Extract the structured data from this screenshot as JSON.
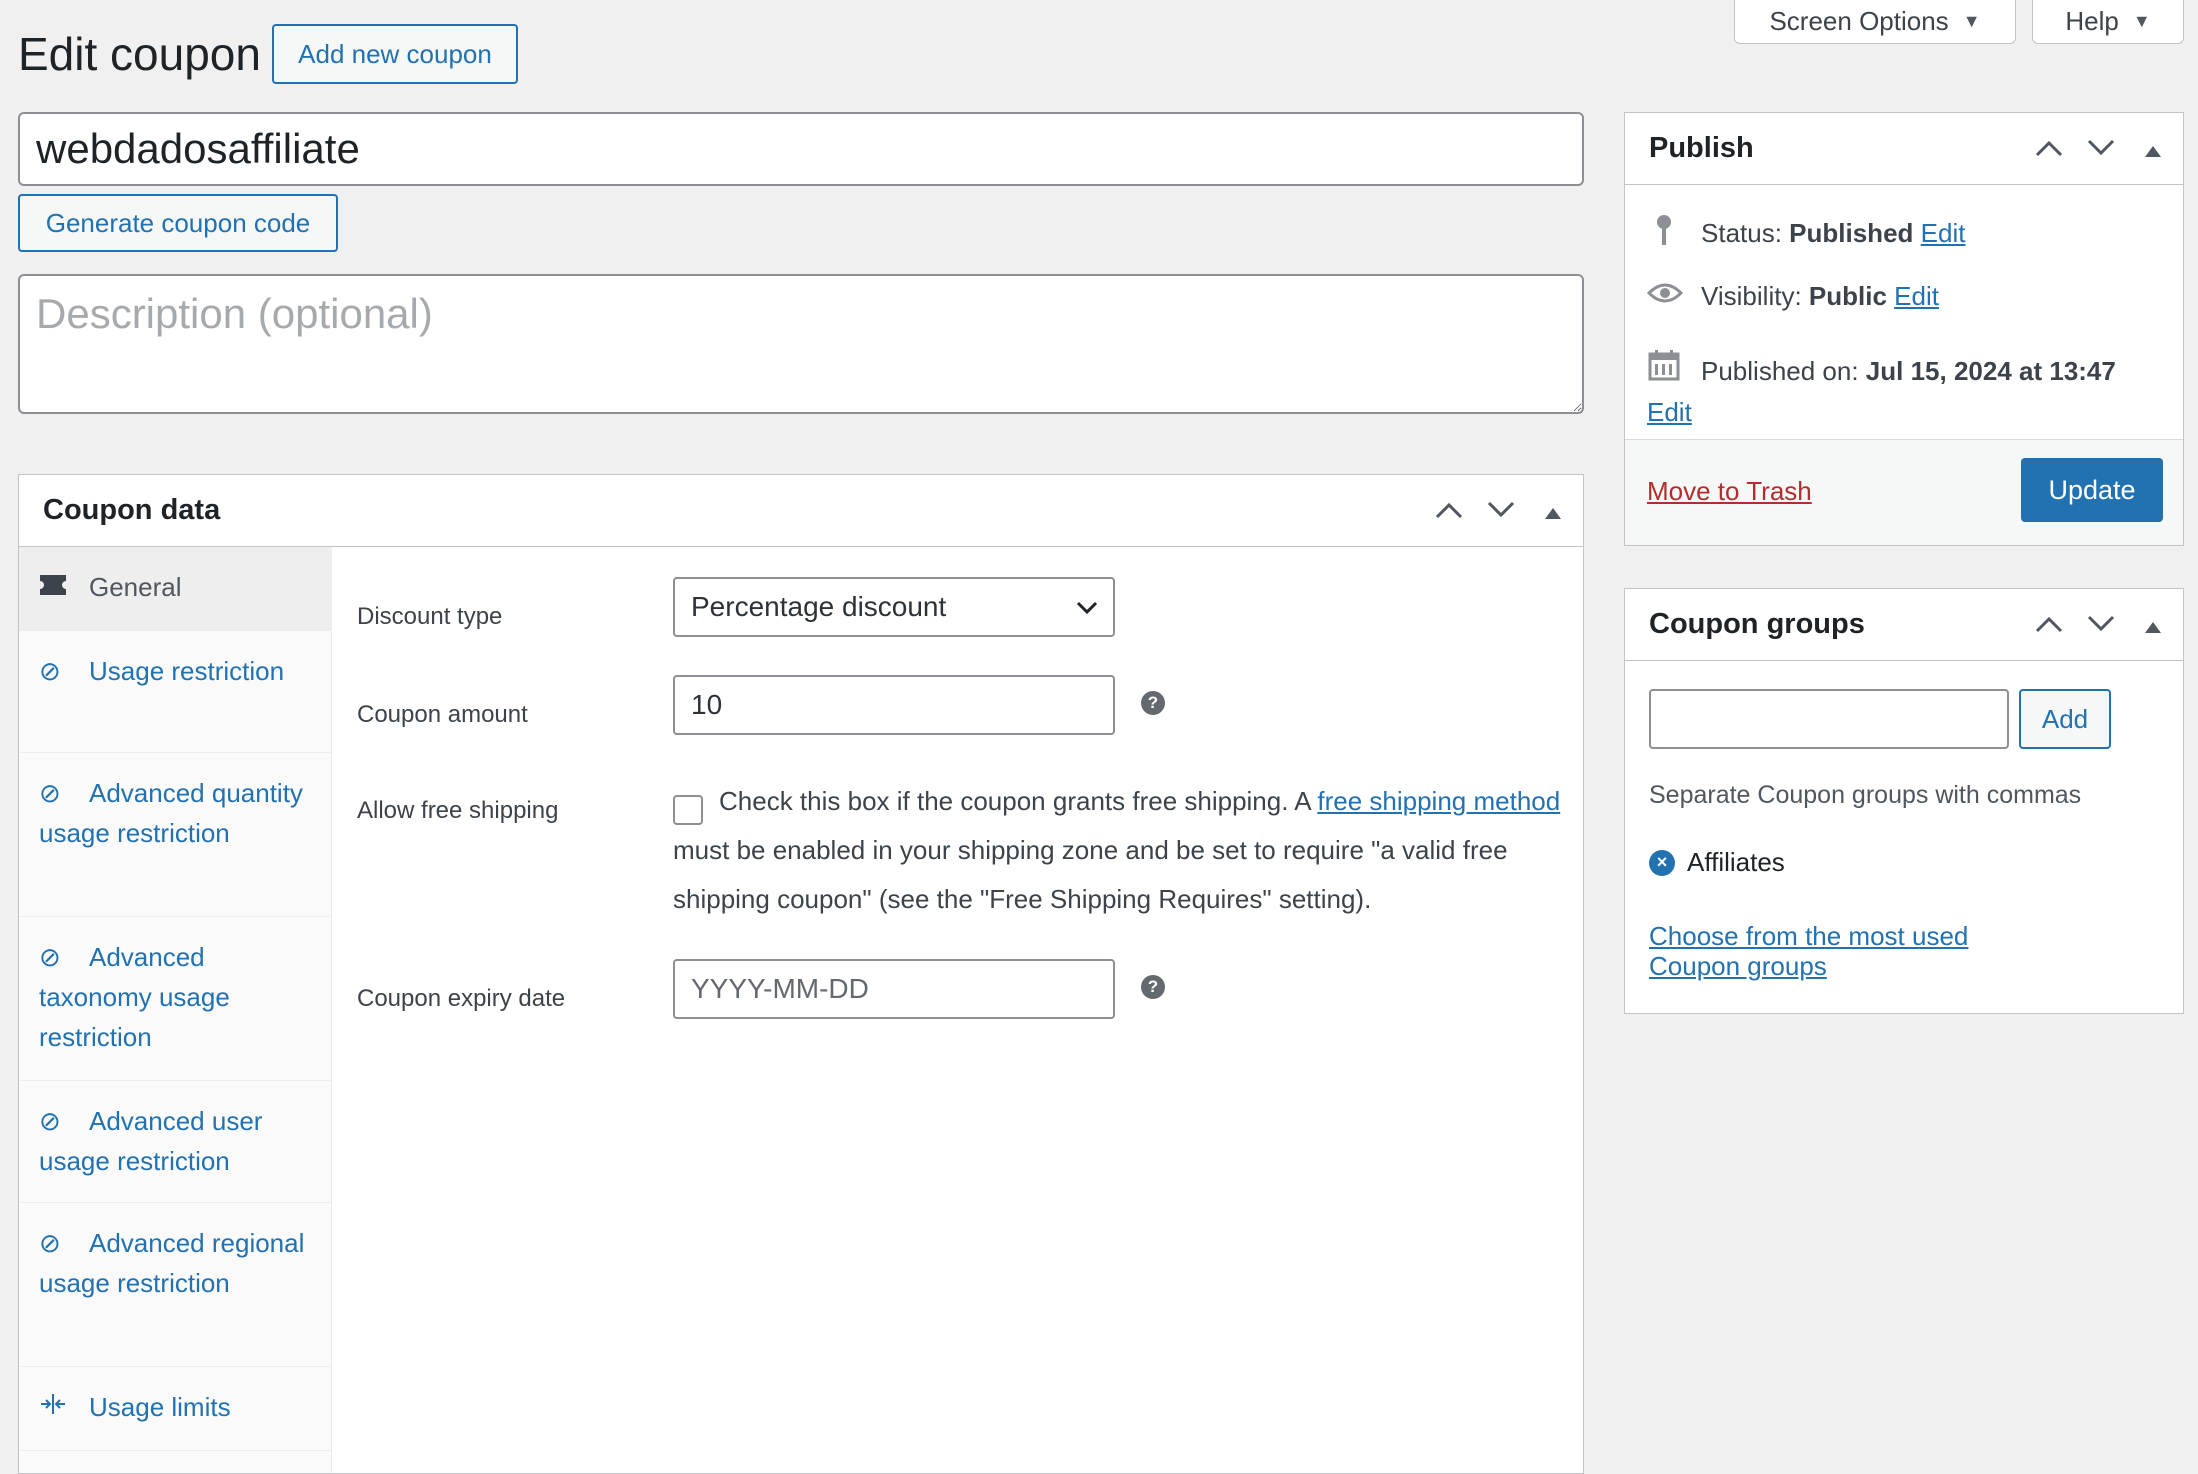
{
  "header": {
    "page_title": "Edit coupon",
    "add_new_label": "Add new coupon",
    "screen_options_label": "Screen Options",
    "help_label": "Help"
  },
  "coupon": {
    "code": "webdadosaffiliate",
    "generate_label": "Generate coupon code",
    "description_placeholder": "Description (optional)"
  },
  "coupon_data": {
    "title": "Coupon data",
    "tabs": [
      {
        "label": "General",
        "icon": "ticket-icon",
        "active": true
      },
      {
        "label": "Usage restriction",
        "icon": "block-icon"
      },
      {
        "label": "Advanced quantity usage restriction",
        "icon": "block-icon"
      },
      {
        "label": "Advanced taxonomy usage restriction",
        "icon": "block-icon"
      },
      {
        "label": "Advanced user usage restriction",
        "icon": "block-icon"
      },
      {
        "label": "Advanced regional usage restriction",
        "icon": "block-icon"
      },
      {
        "label": "Usage limits",
        "icon": "arrows-in-icon"
      }
    ],
    "fields": {
      "discount_type_label": "Discount type",
      "discount_type_value": "Percentage discount",
      "coupon_amount_label": "Coupon amount",
      "coupon_amount_value": "10",
      "free_shipping_label": "Allow free shipping",
      "free_shipping_text_1": "Check this box if the coupon grants free shipping. A ",
      "free_shipping_link": "free shipping method",
      "free_shipping_text_2": " must be enabled in your shipping zone and be set to require \"a valid free shipping coupon\" (see the \"Free Shipping Requires\" setting).",
      "expiry_label": "Coupon expiry date",
      "expiry_placeholder": "YYYY-MM-DD"
    }
  },
  "publish": {
    "title": "Publish",
    "status_label": "Status:",
    "status_value": "Published",
    "visibility_label": "Visibility:",
    "visibility_value": "Public",
    "published_label": "Published on:",
    "published_value": "Jul 15, 2024 at 13:47",
    "edit_label": "Edit",
    "trash_label": "Move to Trash",
    "update_label": "Update"
  },
  "groups": {
    "title": "Coupon groups",
    "add_label": "Add",
    "hint": "Separate Coupon groups with commas",
    "tags": [
      "Affiliates"
    ],
    "most_used_link": "Choose from the most used Coupon groups"
  },
  "colors": {
    "accent": "#2271b1",
    "danger": "#b32d2e",
    "background": "#f0f0f1"
  }
}
